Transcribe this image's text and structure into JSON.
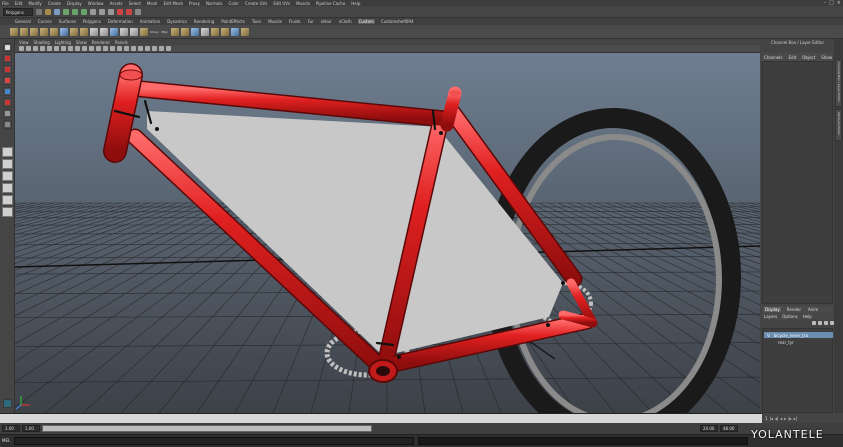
{
  "menubar": {
    "items": [
      "File",
      "Edit",
      "Modify",
      "Create",
      "Display",
      "Window",
      "Assets",
      "Select",
      "Mesh",
      "Edit Mesh",
      "Proxy",
      "Normals",
      "Color",
      "Create UVs",
      "Edit UVs",
      "Muscle",
      "Pipeline Cache",
      "Help"
    ]
  },
  "status_line": {
    "mode": "Polygons"
  },
  "shelf": {
    "tabs": [
      "General",
      "Curves",
      "Surfaces",
      "Polygons",
      "Deformation",
      "Animation",
      "Dynamics",
      "Rendering",
      "PaintEffects",
      "Toon",
      "Muscle",
      "Fluids",
      "Fur",
      "nHair",
      "nCloth",
      "Custom",
      "Customshelf094"
    ],
    "active_tab": "Custom",
    "labels": [
      "Smoo",
      "Mlpl"
    ]
  },
  "viewport": {
    "panel_menu": [
      "View",
      "Shading",
      "Lighting",
      "Show",
      "Renderer",
      "Panels"
    ],
    "colors": {
      "bg_top": "#6e7e90",
      "bg_bottom": "#3d4148",
      "frame_red": "#e02020",
      "panel_grey": "#c8c8c8",
      "tire_black": "#1a1a1a",
      "rim_grey": "#8a8a8a"
    }
  },
  "channel_box": {
    "title": "Channel Box / Layer Editor",
    "menu": [
      "Channels",
      "Edit",
      "Object",
      "Show"
    ]
  },
  "side_tabs": [
    "Channel Box / Layer Editor",
    "Attribute Editor"
  ],
  "layer_editor": {
    "tabs": [
      "Display",
      "Render",
      "Anim"
    ],
    "active_tab": "Display",
    "menu": [
      "Layers",
      "Options",
      "Help"
    ],
    "layers": [
      {
        "vis": "V",
        "name": "bicycle_rever_tra"
      },
      {
        "vis": "",
        "name": "rear_tyr"
      }
    ]
  },
  "time": {
    "start": "1.00",
    "range_start": "1.00",
    "current": "1",
    "range_end": "24.00",
    "end": "48.00"
  },
  "command_line": {
    "label": "MEL"
  },
  "watermark": "YOLANTELE"
}
